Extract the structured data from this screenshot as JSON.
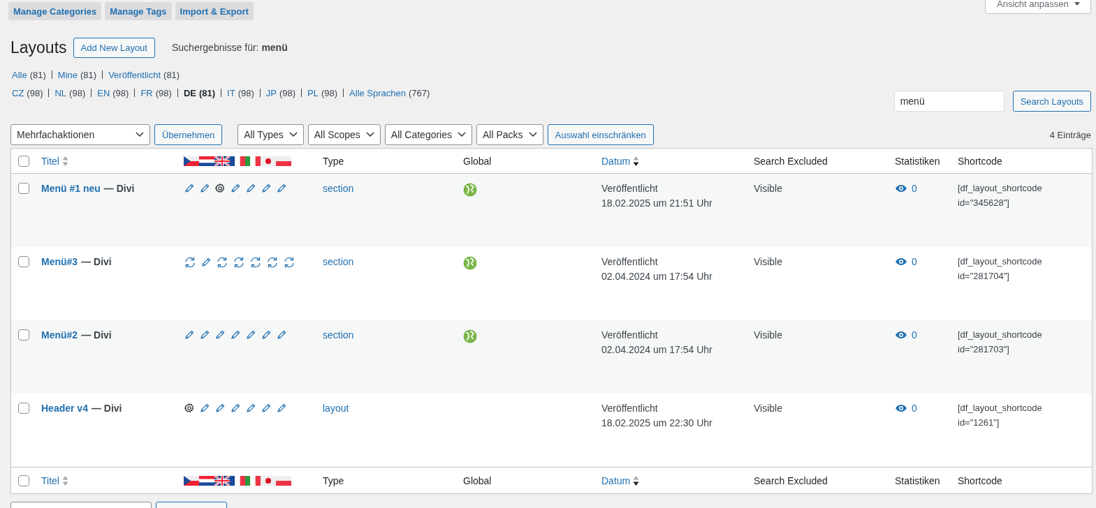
{
  "top_nav": [
    {
      "label": "Manage Categories"
    },
    {
      "label": "Manage Tags"
    },
    {
      "label": "Import & Export"
    }
  ],
  "screen_options": {
    "label": "Ansicht anpassen"
  },
  "page_title": "Layouts",
  "add_button": "Add New Layout",
  "search_results": "Suchergebnisse für: **menü**",
  "status_filters": [
    {
      "label": "Alle",
      "count": "(81)",
      "selected": false
    },
    {
      "label": "Mine",
      "count": "(81)",
      "selected": false
    },
    {
      "label": "Veröffentlicht",
      "count": "(81)",
      "selected": false
    }
  ],
  "language_filters": [
    {
      "label": "CZ",
      "count": "(98)",
      "selected": false
    },
    {
      "label": "NL",
      "count": "(98)",
      "selected": false
    },
    {
      "label": "EN",
      "count": "(98)",
      "selected": false
    },
    {
      "label": "FR",
      "count": "(98)",
      "selected": false
    },
    {
      "label": "DE",
      "count": "(81)",
      "selected": true
    },
    {
      "label": "IT",
      "count": "(98)",
      "selected": false
    },
    {
      "label": "JP",
      "count": "(98)",
      "selected": false
    },
    {
      "label": "PL",
      "count": "(98)",
      "selected": false
    },
    {
      "label": "Alle Sprachen",
      "count": "(767)",
      "selected": false
    }
  ],
  "search": {
    "value": "menü",
    "button": "Search Layouts"
  },
  "bulk_actions": {
    "value": "Mehrfachaktionen",
    "button": "Übernehmen"
  },
  "filters": [
    {
      "label": "All Types"
    },
    {
      "label": "All Scopes"
    },
    {
      "label": "All Categories"
    },
    {
      "label": "All Packs"
    }
  ],
  "filter_button": "Auswahl einschränken",
  "item_count": "4 Einträge",
  "table": {
    "select_all_checked": false,
    "languages": [
      {
        "kind": "cz"
      },
      {
        "kind": "nl"
      },
      {
        "kind": "uk"
      },
      {
        "kind": "fr"
      },
      {
        "kind": "it"
      },
      {
        "kind": "jp"
      },
      {
        "kind": "pl"
      }
    ],
    "header": [
      {
        "label": "Titel",
        "sortable": true
      },
      {
        "label": "Type",
        "sortable": false
      },
      {
        "label": "Global",
        "sortable": false
      },
      {
        "label": "Datum",
        "sortable": true
      },
      {
        "label": "Search Excluded",
        "sortable": false
      },
      {
        "label": "Statistiken",
        "sortable": false
      },
      {
        "label": "Shortcode",
        "sortable": false
      }
    ],
    "footer": [
      {
        "label": "Titel",
        "sortable": true
      },
      {
        "label": "Type",
        "sortable": false
      },
      {
        "label": "Global",
        "sortable": false
      },
      {
        "label": "Datum",
        "sortable": true
      },
      {
        "label": "Search Excluded",
        "sortable": false
      },
      {
        "label": "Statistiken",
        "sortable": false
      },
      {
        "label": "Shortcode",
        "sortable": false
      }
    ],
    "rows": [
      {
        "checked": false,
        "title": "Menü #1 neu",
        "suffix": "— Divi",
        "translations": [
          {
            "kind": "edit"
          },
          {
            "kind": "edit"
          },
          {
            "kind": "settings"
          },
          {
            "kind": "edit"
          },
          {
            "kind": "edit"
          },
          {
            "kind": "edit"
          },
          {
            "kind": "edit"
          }
        ],
        "type": "section",
        "global": true,
        "status": "Veröffentlicht",
        "date": "18.02.2025 um 21:51 Uhr",
        "search_excluded": "Visible",
        "views": "0",
        "shortcode": "[df_layout_shortcode id=\"345628\"]"
      },
      {
        "checked": false,
        "title": "Menü#3",
        "suffix": "— Divi",
        "translations": [
          {
            "kind": "sync"
          },
          {
            "kind": "edit"
          },
          {
            "kind": "sync"
          },
          {
            "kind": "sync"
          },
          {
            "kind": "sync"
          },
          {
            "kind": "sync"
          },
          {
            "kind": "sync"
          }
        ],
        "type": "section",
        "global": true,
        "status": "Veröffentlicht",
        "date": "02.04.2024 um 17:54 Uhr",
        "search_excluded": "Visible",
        "views": "0",
        "shortcode": "[df_layout_shortcode id=\"281704\"]"
      },
      {
        "checked": false,
        "title": "Menü#2",
        "suffix": "— Divi",
        "translations": [
          {
            "kind": "edit"
          },
          {
            "kind": "edit"
          },
          {
            "kind": "edit"
          },
          {
            "kind": "edit"
          },
          {
            "kind": "edit"
          },
          {
            "kind": "edit"
          },
          {
            "kind": "edit"
          }
        ],
        "type": "section",
        "global": true,
        "status": "Veröffentlicht",
        "date": "02.04.2024 um 17:54 Uhr",
        "search_excluded": "Visible",
        "views": "0",
        "shortcode": "[df_layout_shortcode id=\"281703\"]"
      },
      {
        "checked": false,
        "title": "Header v4",
        "suffix": "— Divi",
        "translations": [
          {
            "kind": "settings"
          },
          {
            "kind": "edit"
          },
          {
            "kind": "edit"
          },
          {
            "kind": "edit"
          },
          {
            "kind": "edit"
          },
          {
            "kind": "edit"
          },
          {
            "kind": "edit"
          }
        ],
        "type": "layout",
        "global": false,
        "status": "Veröffentlicht",
        "date": "18.02.2025 um 22:30 Uhr",
        "search_excluded": "Visible",
        "views": "0",
        "shortcode": "[df_layout_shortcode id=\"1261\"]"
      }
    ]
  }
}
